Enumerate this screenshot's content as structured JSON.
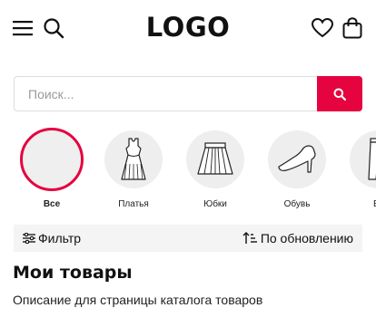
{
  "header": {
    "logo": "LOGO",
    "icons": [
      "menu-icon",
      "search-icon",
      "heart-icon",
      "bag-icon"
    ]
  },
  "search": {
    "placeholder": "Поиск...",
    "value": "",
    "submit_icon": "search-icon",
    "accent": "#e5043f"
  },
  "categories": [
    {
      "label": "Все",
      "icon": "none",
      "selected": true
    },
    {
      "label": "Платья",
      "icon": "dress-icon",
      "selected": false
    },
    {
      "label": "Юбки",
      "icon": "skirt-icon",
      "selected": false
    },
    {
      "label": "Обувь",
      "icon": "shoe-icon",
      "selected": false
    },
    {
      "label": "Бр",
      "icon": "pants-icon",
      "selected": false
    }
  ],
  "toolbar": {
    "filter_label": "Фильтр",
    "filter_icon": "sliders-icon",
    "sort_label": "По обновлению",
    "sort_icon": "sort-icon"
  },
  "page": {
    "title": "Мои товары",
    "description": "Описание для страницы каталога товаров"
  }
}
